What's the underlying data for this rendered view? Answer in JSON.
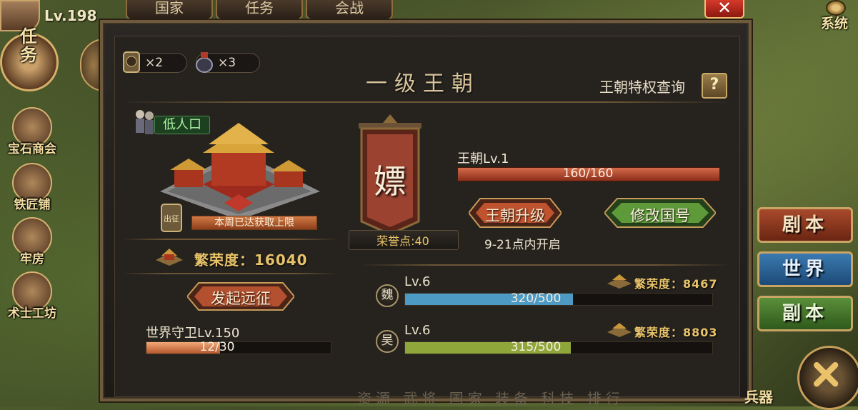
{
  "player": {
    "level": "Lv.198"
  },
  "top_tabs": [
    "国家",
    "任务",
    "会战"
  ],
  "system": {
    "label": "系统"
  },
  "sidebar": {
    "quest": "任务",
    "items": [
      {
        "label": "宝石商会",
        "icon": "gem-merchant-icon"
      },
      {
        "label": "铁匠铺",
        "icon": "anvil-icon"
      },
      {
        "label": "牢房",
        "icon": "prison-icon"
      },
      {
        "label": "术士工坊",
        "icon": "yin-yang-icon"
      }
    ]
  },
  "resources": [
    {
      "icon": "expedition-token-icon",
      "count": "×2"
    },
    {
      "icon": "potion-jar-icon",
      "count": "×3"
    }
  ],
  "dialog": {
    "title": "一级王朝",
    "privilege_label": "王朝特权查询",
    "help": "?"
  },
  "left_panel": {
    "population": "低人口",
    "weekly_status": "本周已达获取上限",
    "prosperity": "繁荣度：16040",
    "expedition_button": "发起远征",
    "guard_label": "世界守卫Lv.150",
    "guard_value": "12/30",
    "guard_progress": 0.4
  },
  "banner": {
    "character": "嫖",
    "honor": "荣誉点:40"
  },
  "dynasty": {
    "level": "王朝Lv.1",
    "progress_text": "160/160",
    "progress": 1.0,
    "upgrade_button": "王朝升级",
    "rename_button": "修改国号",
    "upgrade_hint": "9-21点内开启"
  },
  "kingdoms": [
    {
      "emblem": "魏",
      "level": "Lv.6",
      "progress_text": "320/500",
      "progress": 0.64,
      "prosperity": "繁荣度：8467",
      "color": "#4d9ac4"
    },
    {
      "emblem": "吴",
      "level": "Lv.6",
      "progress_text": "315/500",
      "progress": 0.63,
      "prosperity": "繁荣度：8803",
      "color": "#8fa63a"
    }
  ],
  "right_buttons": [
    "剧本",
    "世界",
    "副本"
  ],
  "bottom": {
    "nav": "资源 武将 国家 装备 科技 排行",
    "right_label": "兵器"
  }
}
